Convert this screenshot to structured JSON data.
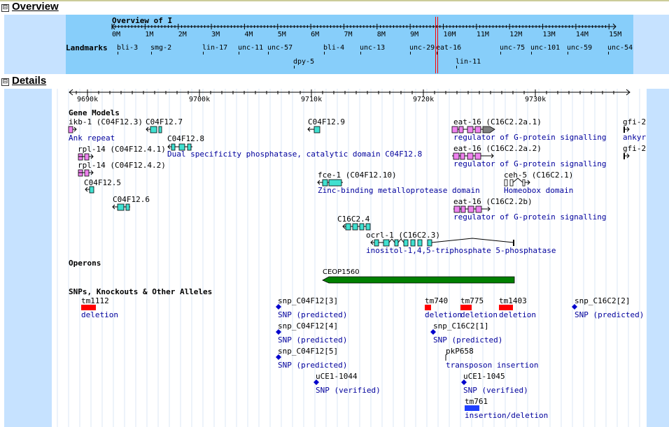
{
  "overview": {
    "toggle": "⊟",
    "title": "Overview",
    "chrom_title": "Overview of I",
    "ticks": [
      "0M",
      "1M",
      "2M",
      "3M",
      "4M",
      "5M",
      "6M",
      "7M",
      "8M",
      "9M",
      "10M",
      "11M",
      "12M",
      "13M",
      "14M",
      "15M"
    ],
    "landmarks_label": "Landmarks",
    "landmarks": [
      "bli-3",
      "smg-2",
      "lin-17",
      "unc-11",
      "unc-57",
      "dpy-5",
      "bli-4",
      "unc-13",
      "unc-29",
      "eat-16",
      "lin-11",
      "unc-75",
      "unc-101",
      "unc-59",
      "unc-54"
    ]
  },
  "details": {
    "toggle": "⊟",
    "title": "Details",
    "ruler": [
      "9690k",
      "9700k",
      "9710k",
      "9720k",
      "9730k"
    ],
    "gene_models_label": "Gene Models",
    "genes": [
      {
        "name": "ikb-1 (C04F12.3)",
        "desc": "Ank repeat"
      },
      {
        "name": "C04F12.7",
        "desc": ""
      },
      {
        "name": "C04F12.8",
        "desc": "Dual specificity phosphatase, catalytic domain C04F12.8"
      },
      {
        "name": "rpl-14 (C04F12.4.1)",
        "desc": ""
      },
      {
        "name": "rpl-14 (C04F12.4.2)",
        "desc": ""
      },
      {
        "name": "C04F12.5",
        "desc": ""
      },
      {
        "name": "C04F12.6",
        "desc": ""
      },
      {
        "name": "C04F12.9",
        "desc": ""
      },
      {
        "name": "fce-1 (C04F12.10)",
        "desc": "Zinc-binding metalloprotease domain"
      },
      {
        "name": "C16C2.4",
        "desc": ""
      },
      {
        "name": "ocrl-1 (C16C2.3)",
        "desc": "inositol-1,4,5-triphosphate 5-phosphatase"
      },
      {
        "name": "eat-16 (C16C2.2a.1)",
        "desc": "regulator of G-protein signalling"
      },
      {
        "name": "eat-16 (C16C2.2a.2)",
        "desc": "regulator of G-protein signalling"
      },
      {
        "name": "ceh-5 (C16C2.1)",
        "desc": "Homeobox domain"
      },
      {
        "name": "eat-16 (C16C2.2b)",
        "desc": "regulator of G-protein signalling"
      },
      {
        "name": "gfi-2",
        "desc": "ankyri"
      },
      {
        "name": "gfi-2",
        "desc": ""
      }
    ],
    "operons_label": "Operons",
    "operon": "CEOP1560",
    "alleles_label": "SNPs, Knockouts & Other Alleles",
    "alleles": [
      {
        "name": "tm1112",
        "desc": "deletion"
      },
      {
        "name": "snp_C04F12[3]",
        "desc": "SNP (predicted)"
      },
      {
        "name": "snp_C04F12[4]",
        "desc": "SNP (predicted)"
      },
      {
        "name": "snp_C04F12[5]",
        "desc": "SNP (predicted)"
      },
      {
        "name": "uCE1-1044",
        "desc": "SNP (verified)"
      },
      {
        "name": "tm740",
        "desc": "deletion"
      },
      {
        "name": "tm775",
        "desc": "deletion"
      },
      {
        "name": "tm1403",
        "desc": "deletion"
      },
      {
        "name": "snp_C16C2[1]",
        "desc": "SNP (predicted)"
      },
      {
        "name": "pkP658",
        "desc": "transposon insertion"
      },
      {
        "name": "uCE1-1045",
        "desc": "SNP (verified)"
      },
      {
        "name": "tm761",
        "desc": "insertion/deletion"
      },
      {
        "name": "snp_C16C2[2]",
        "desc": "SNP (predicted)"
      }
    ]
  },
  "colors": {
    "overview_bg": "#87cefa",
    "panel_bg": "#c6e2ff",
    "exon_cyan": "#40e0d0",
    "exon_pink": "#ee82ee",
    "operon_green": "#008000",
    "deletion_red": "#ff0000",
    "snp_blue": "#0000cd",
    "indel_blue": "#2040ff",
    "desc_blue": "#00009c",
    "viewport_red": "#ff0000"
  }
}
